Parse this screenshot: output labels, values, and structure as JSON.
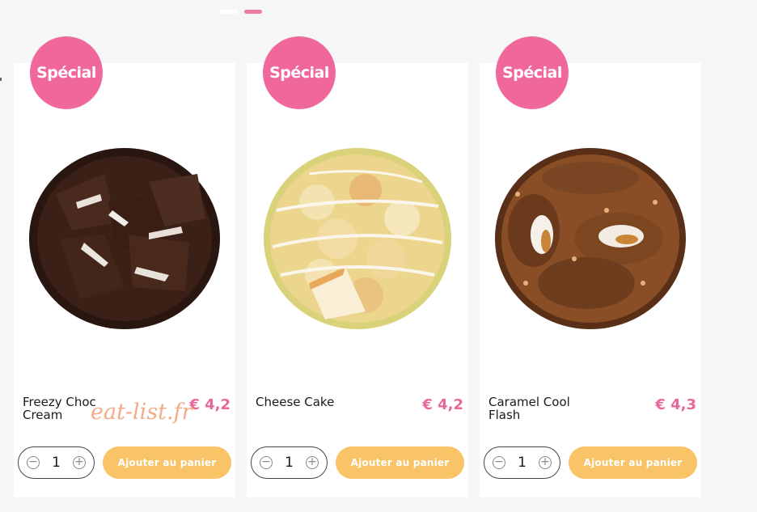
{
  "carousel": {
    "dot_colors": [
      "#ffffff",
      "#f07aa6"
    ]
  },
  "badge_color": "#f0679c",
  "price_color": "#e8689c",
  "button_color": "#f9c468",
  "products": [
    {
      "badge": "Spécial",
      "name": "Freezy Choc Cream",
      "price": "€ 4,2",
      "quantity": "1",
      "decrement_icon": "minus-circle-icon",
      "increment_icon": "plus-circle-icon",
      "add_label": "Ajouter au panier",
      "image": "chocolate-donut-image"
    },
    {
      "badge": "Spécial",
      "name": "Cheese Cake",
      "price": "€ 4,2",
      "quantity": "1",
      "decrement_icon": "minus-circle-icon",
      "increment_icon": "plus-circle-icon",
      "add_label": "Ajouter au panier",
      "image": "cheesecake-donut-image"
    },
    {
      "badge": "Spécial",
      "name": "Caramel Cool Flash",
      "price": "€ 4,3",
      "quantity": "1",
      "decrement_icon": "minus-circle-icon",
      "increment_icon": "plus-circle-icon",
      "add_label": "Ajouter au panier",
      "image": "caramel-donut-image"
    }
  ],
  "watermark": "eat-list.fr"
}
